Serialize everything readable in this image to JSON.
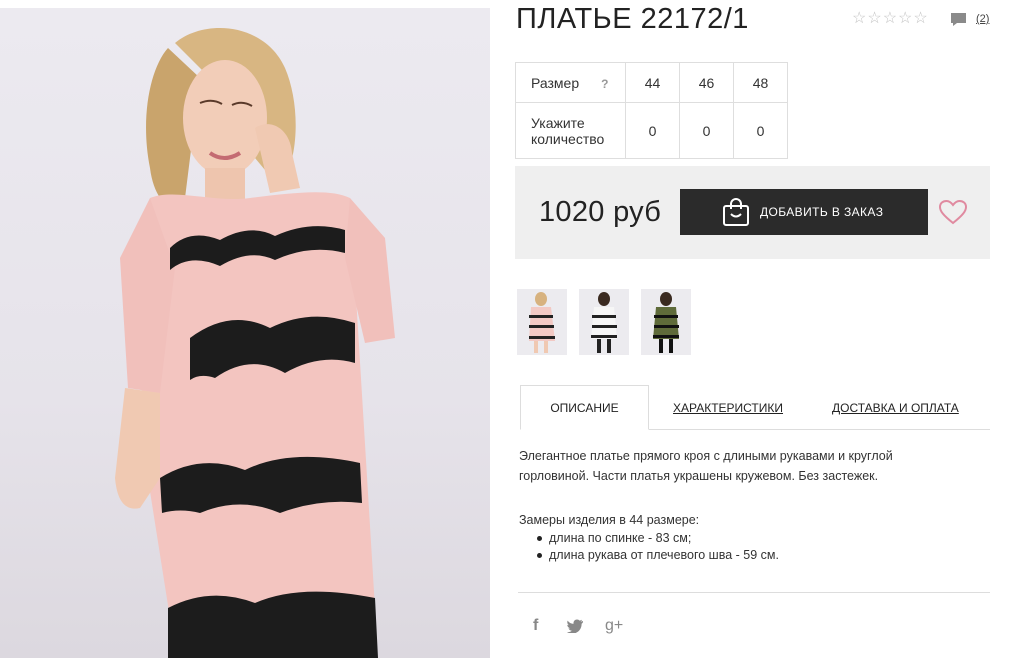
{
  "product": {
    "title": "ПЛАТЬЕ 22172/1",
    "rating_stars": 5,
    "rating_value": 0,
    "review_count": "(2)"
  },
  "sizes": {
    "size_label": "Размер",
    "help_mark": "?",
    "quantity_label_1": "Укажите",
    "quantity_label_2": "количество",
    "options": [
      {
        "size": "44",
        "qty": "0"
      },
      {
        "size": "46",
        "qty": "0"
      },
      {
        "size": "48",
        "qty": "0"
      }
    ]
  },
  "purchase": {
    "price": "1020 руб",
    "add_button": "ДОБАВИТЬ В ЗАКАЗ"
  },
  "thumbnails": [
    {
      "name": "pink-dress",
      "color": "#f2c9c4"
    },
    {
      "name": "white-dress",
      "color": "#f4f4f4"
    },
    {
      "name": "olive-dress",
      "color": "#5f6b3a"
    }
  ],
  "tabs": [
    {
      "label": "ОПИСАНИЕ",
      "active": true
    },
    {
      "label": "ХАРАКТЕРИСТИКИ",
      "active": false
    },
    {
      "label": "ДОСТАВКА И ОПЛАТА",
      "active": false
    }
  ],
  "description": {
    "text_line1": "Элегантное платье прямого кроя с длиными рукавами и круглой",
    "text_line2": "горловиной. Части платья украшены кружевом. Без застежек.",
    "measure_title": "Замеры изделия в 44 размере:",
    "measures": [
      "длина по спинке - 83 см;",
      "длина рукава от плечевого шва - 59 см."
    ]
  },
  "social": {
    "facebook": "f",
    "twitter": "twitter-icon",
    "google": "g+"
  },
  "colors": {
    "dress": "#f3c5c0",
    "lace": "#1c1c1c",
    "button": "#2b2b2b",
    "heart": "#e08aa0"
  }
}
